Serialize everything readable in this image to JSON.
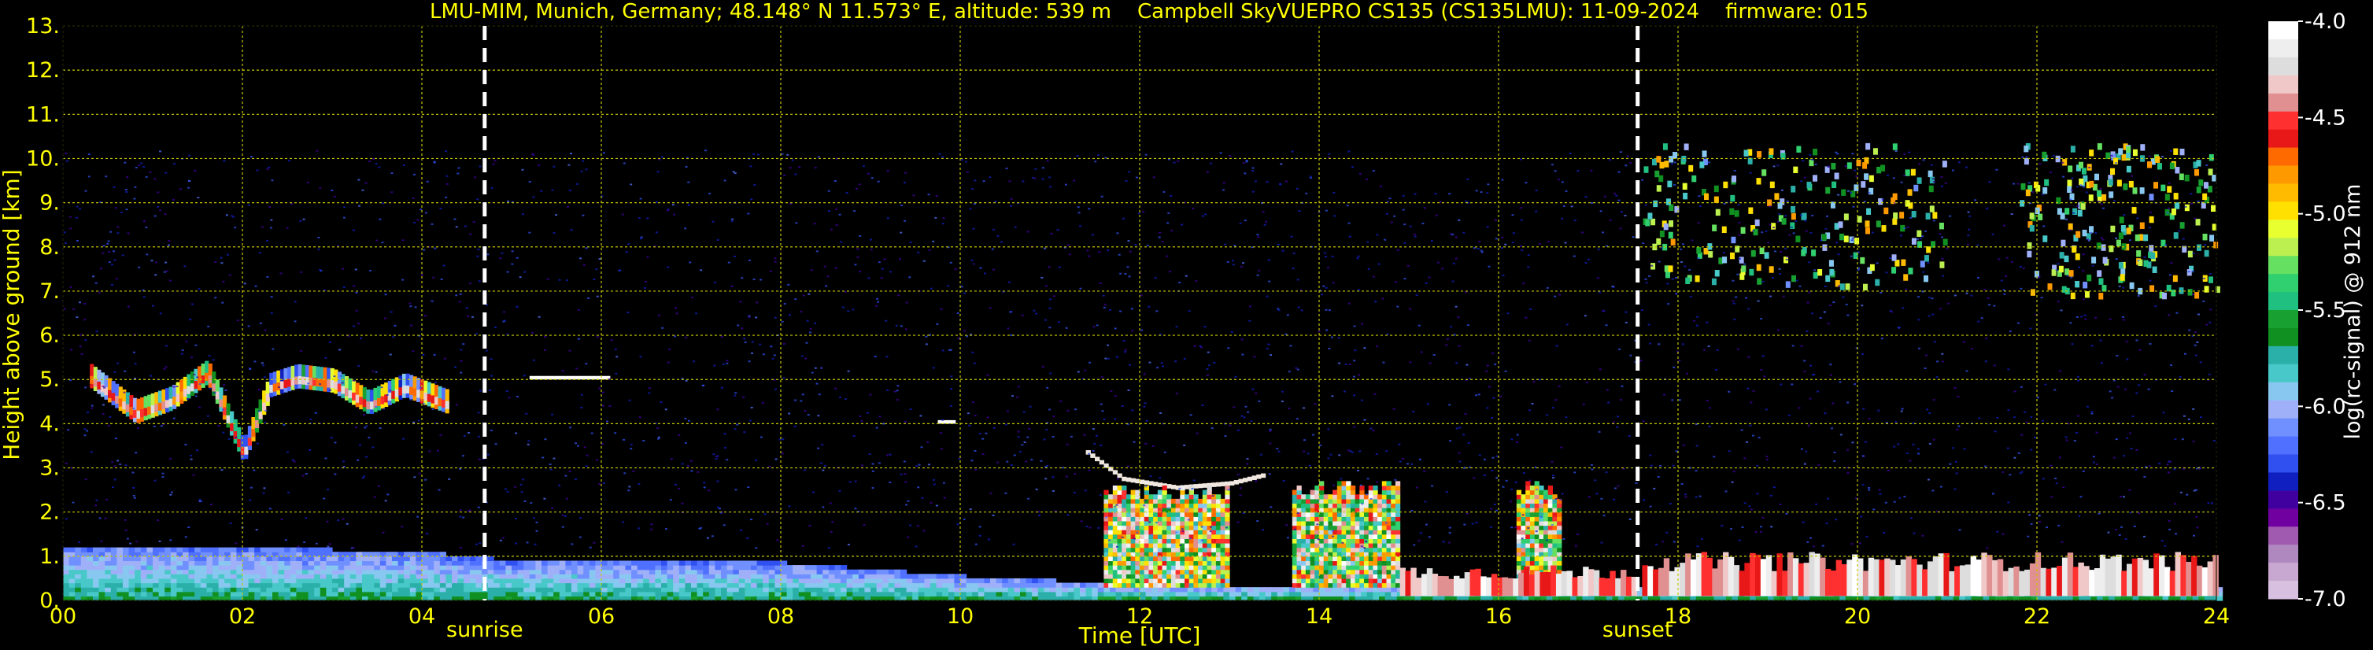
{
  "chart_data": {
    "type": "heatmap",
    "title": "LMU-MIM, Munich, Germany; 48.148° N 11.573° E, altitude: 539 m    Campbell SkyVUEPRO CS135 (CS135LMU): 11-09-2024    firmware: 015",
    "xlabel": "Time [UTC]",
    "ylabel": "Height above ground [km]",
    "xlim": [
      0,
      24
    ],
    "ylim": [
      0,
      13
    ],
    "x_ticks": [
      "00",
      "02",
      "04",
      "06",
      "08",
      "10",
      "12",
      "14",
      "16",
      "18",
      "20",
      "22",
      "24"
    ],
    "y_ticks": [
      "0.",
      "1.",
      "2.",
      "3.",
      "4.",
      "5.",
      "6.",
      "7.",
      "8.",
      "9.",
      "10.",
      "11.",
      "12.",
      "13."
    ],
    "grid": true,
    "grid_color": "#c8c800",
    "signal_top_km": 10.2,
    "markers": [
      {
        "label": "sunrise",
        "time": 4.7
      },
      {
        "label": "sunset",
        "time": 17.55
      }
    ],
    "features": {
      "aerosol_layer": [
        {
          "t": 0,
          "top": 1.2
        },
        {
          "t": 2,
          "top": 1.15
        },
        {
          "t": 4,
          "top": 1.05
        },
        {
          "t": 4.8,
          "top": 0.9
        },
        {
          "t": 8,
          "top": 0.8
        },
        {
          "t": 10,
          "top": 0.5
        },
        {
          "t": 12,
          "top": 0.3
        },
        {
          "t": 24,
          "top": 0.3
        }
      ],
      "cloud_trace_night": [
        {
          "t": 0.3,
          "h": 4.8
        },
        {
          "t": 0.8,
          "h": 4.0
        },
        {
          "t": 1.2,
          "h": 4.3
        },
        {
          "t": 1.6,
          "h": 4.9
        },
        {
          "t": 2.0,
          "h": 3.1
        },
        {
          "t": 2.3,
          "h": 4.6
        },
        {
          "t": 2.6,
          "h": 4.8
        },
        {
          "t": 3.0,
          "h": 4.7
        },
        {
          "t": 3.4,
          "h": 4.2
        },
        {
          "t": 3.8,
          "h": 4.6
        },
        {
          "t": 4.3,
          "h": 4.2
        }
      ],
      "cloud_fragments": [
        {
          "t0": 5.2,
          "t1": 6.1,
          "h": 5.0
        },
        {
          "t0": 9.75,
          "t1": 9.95,
          "h": 4.0
        }
      ],
      "low_cloud_trace": [
        {
          "t": 11.4,
          "h": 3.3
        },
        {
          "t": 11.8,
          "h": 2.7
        },
        {
          "t": 12.4,
          "h": 2.5
        },
        {
          "t": 13.0,
          "h": 2.6
        },
        {
          "t": 13.4,
          "h": 2.8
        }
      ],
      "convective_blocks": [
        {
          "t0": 11.6,
          "t1": 13.0,
          "top": 2.6
        },
        {
          "t0": 13.7,
          "t1": 14.9,
          "top": 2.7
        },
        {
          "t0": 16.2,
          "t1": 16.7,
          "top": 2.7
        }
      ],
      "surface_saturation": [
        {
          "t0": 14.9,
          "t1": 17.5,
          "top": 0.8
        },
        {
          "t0": 17.6,
          "t1": 24,
          "top": 1.1
        }
      ],
      "evening_clouds": [
        {
          "t0": 17.6,
          "t1": 21.0,
          "h0": 7.0,
          "h1": 10.2
        },
        {
          "t0": 21.8,
          "t1": 24,
          "h0": 6.8,
          "h1": 10.2
        }
      ]
    },
    "colorbar": {
      "label": "log(rc-signal) @ 912 nm",
      "ticks": [
        "-4.0",
        "-4.5",
        "-5.0",
        "-5.5",
        "-6.0",
        "-6.5",
        "-7.0"
      ],
      "range": [
        -7.0,
        -4.0
      ],
      "colors": [
        "#ffffff",
        "#eeeeee",
        "#dddddd",
        "#f0c8c8",
        "#e09090",
        "#ff3030",
        "#e81818",
        "#ff6a00",
        "#ff9900",
        "#ffbb00",
        "#ffe000",
        "#e8ff30",
        "#bbf050",
        "#66e060",
        "#30d070",
        "#20c080",
        "#18a030",
        "#109020",
        "#2ab0a8",
        "#48c8c8",
        "#88c8f0",
        "#a0b0f8",
        "#7090ff",
        "#5070ff",
        "#3050f0",
        "#1020c0",
        "#4000a0",
        "#7000a0",
        "#a05ab0",
        "#b088c0",
        "#c8a8d0",
        "#d8c0e0"
      ]
    }
  }
}
